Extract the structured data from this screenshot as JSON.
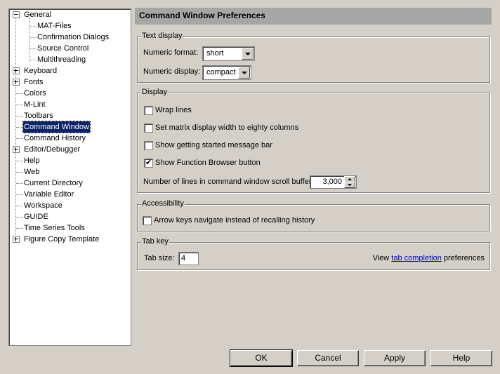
{
  "tree": {
    "items": [
      {
        "label": "General",
        "expander": "minus"
      },
      {
        "label": "MAT-Files"
      },
      {
        "label": "Confirmation Dialogs"
      },
      {
        "label": "Source Control"
      },
      {
        "label": "Multithreading"
      },
      {
        "label": "Keyboard",
        "expander": "plus"
      },
      {
        "label": "Fonts",
        "expander": "plus"
      },
      {
        "label": "Colors"
      },
      {
        "label": "M-Lint"
      },
      {
        "label": "Toolbars"
      },
      {
        "label": "Command Window",
        "selected": true
      },
      {
        "label": "Command History"
      },
      {
        "label": "Editor/Debugger",
        "expander": "plus"
      },
      {
        "label": "Help"
      },
      {
        "label": "Web"
      },
      {
        "label": "Current Directory"
      },
      {
        "label": "Variable Editor"
      },
      {
        "label": "Workspace"
      },
      {
        "label": "GUIDE"
      },
      {
        "label": "Time Series Tools"
      },
      {
        "label": "Figure Copy Template",
        "expander": "plus"
      }
    ]
  },
  "header": {
    "title": "Command Window Preferences"
  },
  "text_display": {
    "title": "Text display",
    "numeric_format_label": "Numeric format:",
    "numeric_format_value": "short",
    "numeric_display_label": "Numeric display:",
    "numeric_display_value": "compact"
  },
  "display": {
    "title": "Display",
    "wrap_lines": {
      "label": "Wrap lines",
      "checked": false
    },
    "matrix_width": {
      "label": "Set matrix display width to eighty columns",
      "checked": false
    },
    "getting_started": {
      "label": "Show getting started message bar",
      "checked": false
    },
    "function_browser": {
      "label": "Show Function Browser button",
      "checked": true
    },
    "scroll_buffer_label": "Number of lines in command window scroll buffer:",
    "scroll_buffer_value": "3,000"
  },
  "accessibility": {
    "title": "Accessibility",
    "arrow_keys": {
      "label": "Arrow keys navigate instead of recalling history",
      "checked": false
    }
  },
  "tab_key": {
    "title": "Tab key",
    "tab_size_label": "Tab size:",
    "tab_size_value": "4",
    "view_prefix": "View",
    "link_text": "tab completion",
    "view_suffix": "preferences"
  },
  "buttons": {
    "ok": "OK",
    "cancel": "Cancel",
    "apply": "Apply",
    "help": "Help"
  },
  "colors": {
    "selection": "#0a246a",
    "header": "#a6a6a6",
    "link": "#0000cc",
    "face": "#d4d0c8"
  }
}
